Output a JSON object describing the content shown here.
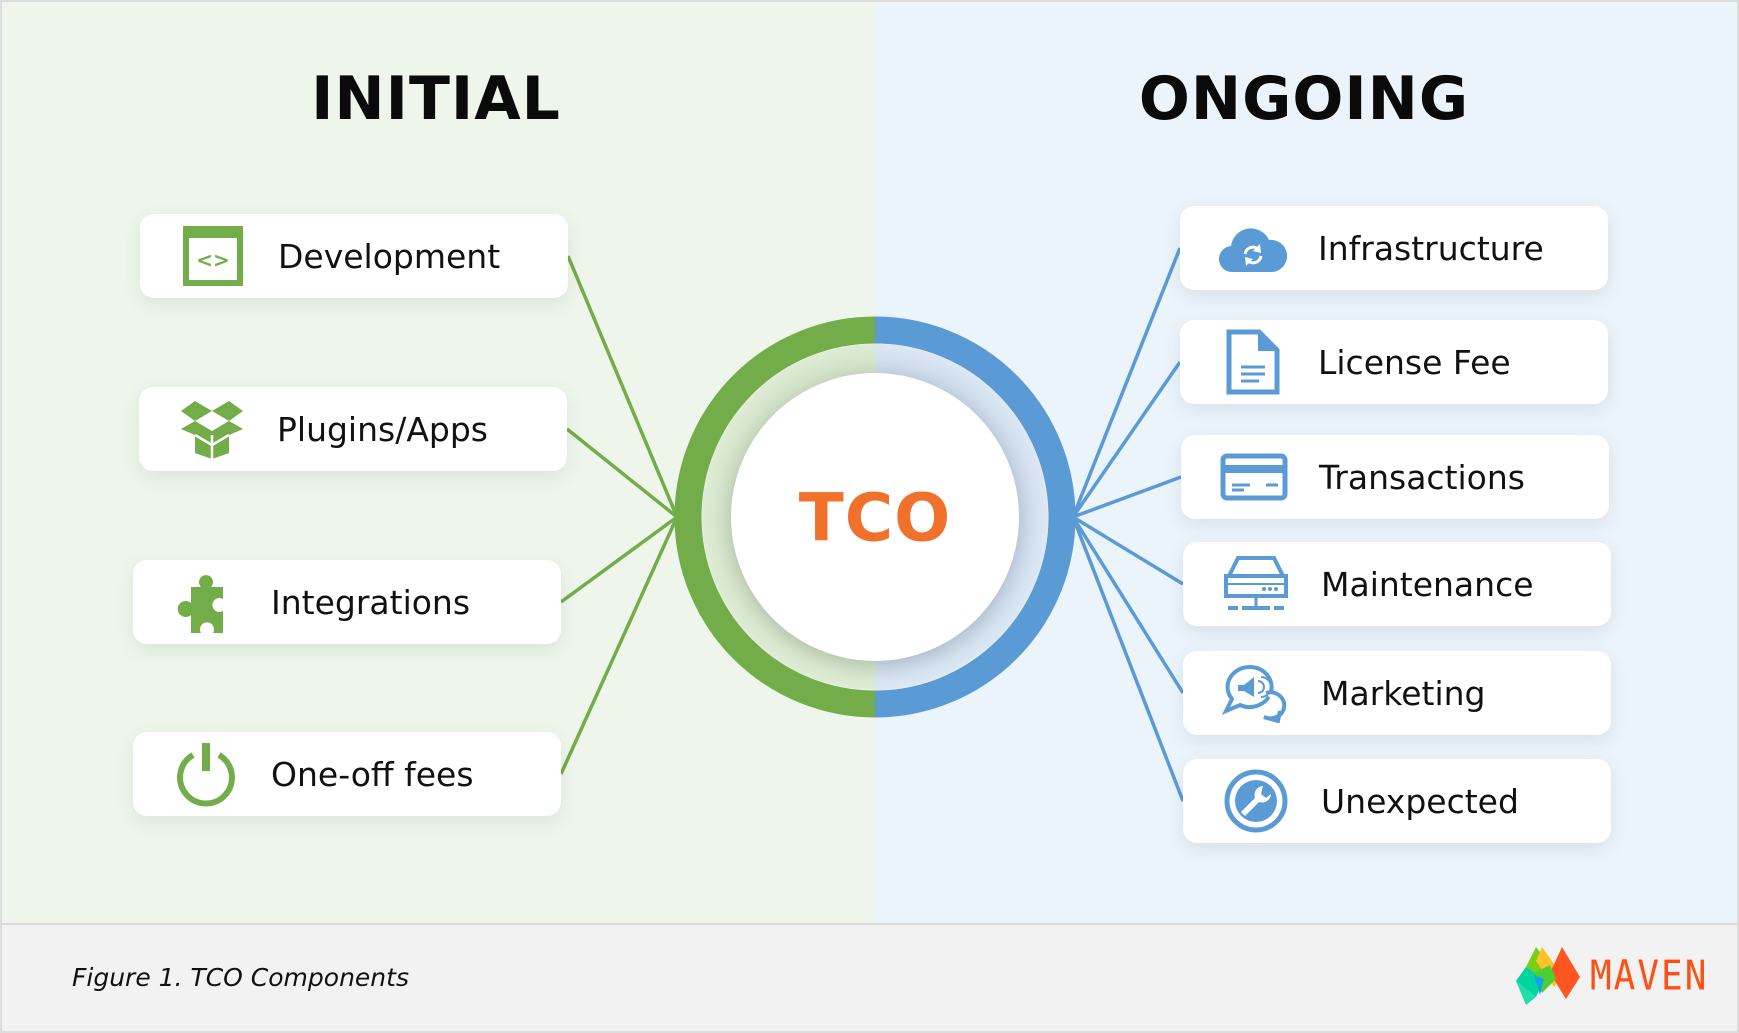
{
  "figure": {
    "center_label": "TCO",
    "caption": "Figure 1. TCO Components",
    "brand": "MAVEN"
  },
  "colors": {
    "initial_accent": "#72ad49",
    "ongoing_accent": "#5b9bd5",
    "tco_text": "#f0712c",
    "initial_bg": "#eef6ec",
    "ongoing_bg": "#ebf3fb",
    "footer_bg": "#f2f2f2",
    "brand": "#ff4f14"
  },
  "initial": {
    "title": "INITIAL",
    "items": [
      {
        "label": "Development",
        "icon": "code-window-icon"
      },
      {
        "label": "Plugins/Apps",
        "icon": "open-box-icon"
      },
      {
        "label": "Integrations",
        "icon": "puzzle-piece-icon"
      },
      {
        "label": "One-off fees",
        "icon": "power-icon"
      }
    ]
  },
  "ongoing": {
    "title": "ONGOING",
    "items": [
      {
        "label": "Infrastructure",
        "icon": "cloud-sync-icon"
      },
      {
        "label": "License Fee",
        "icon": "document-icon"
      },
      {
        "label": "Transactions",
        "icon": "credit-card-icon"
      },
      {
        "label": "Maintenance",
        "icon": "server-network-icon"
      },
      {
        "label": "Marketing",
        "icon": "megaphone-chat-icon"
      },
      {
        "label": "Unexpected",
        "icon": "wrench-circle-icon"
      }
    ]
  }
}
